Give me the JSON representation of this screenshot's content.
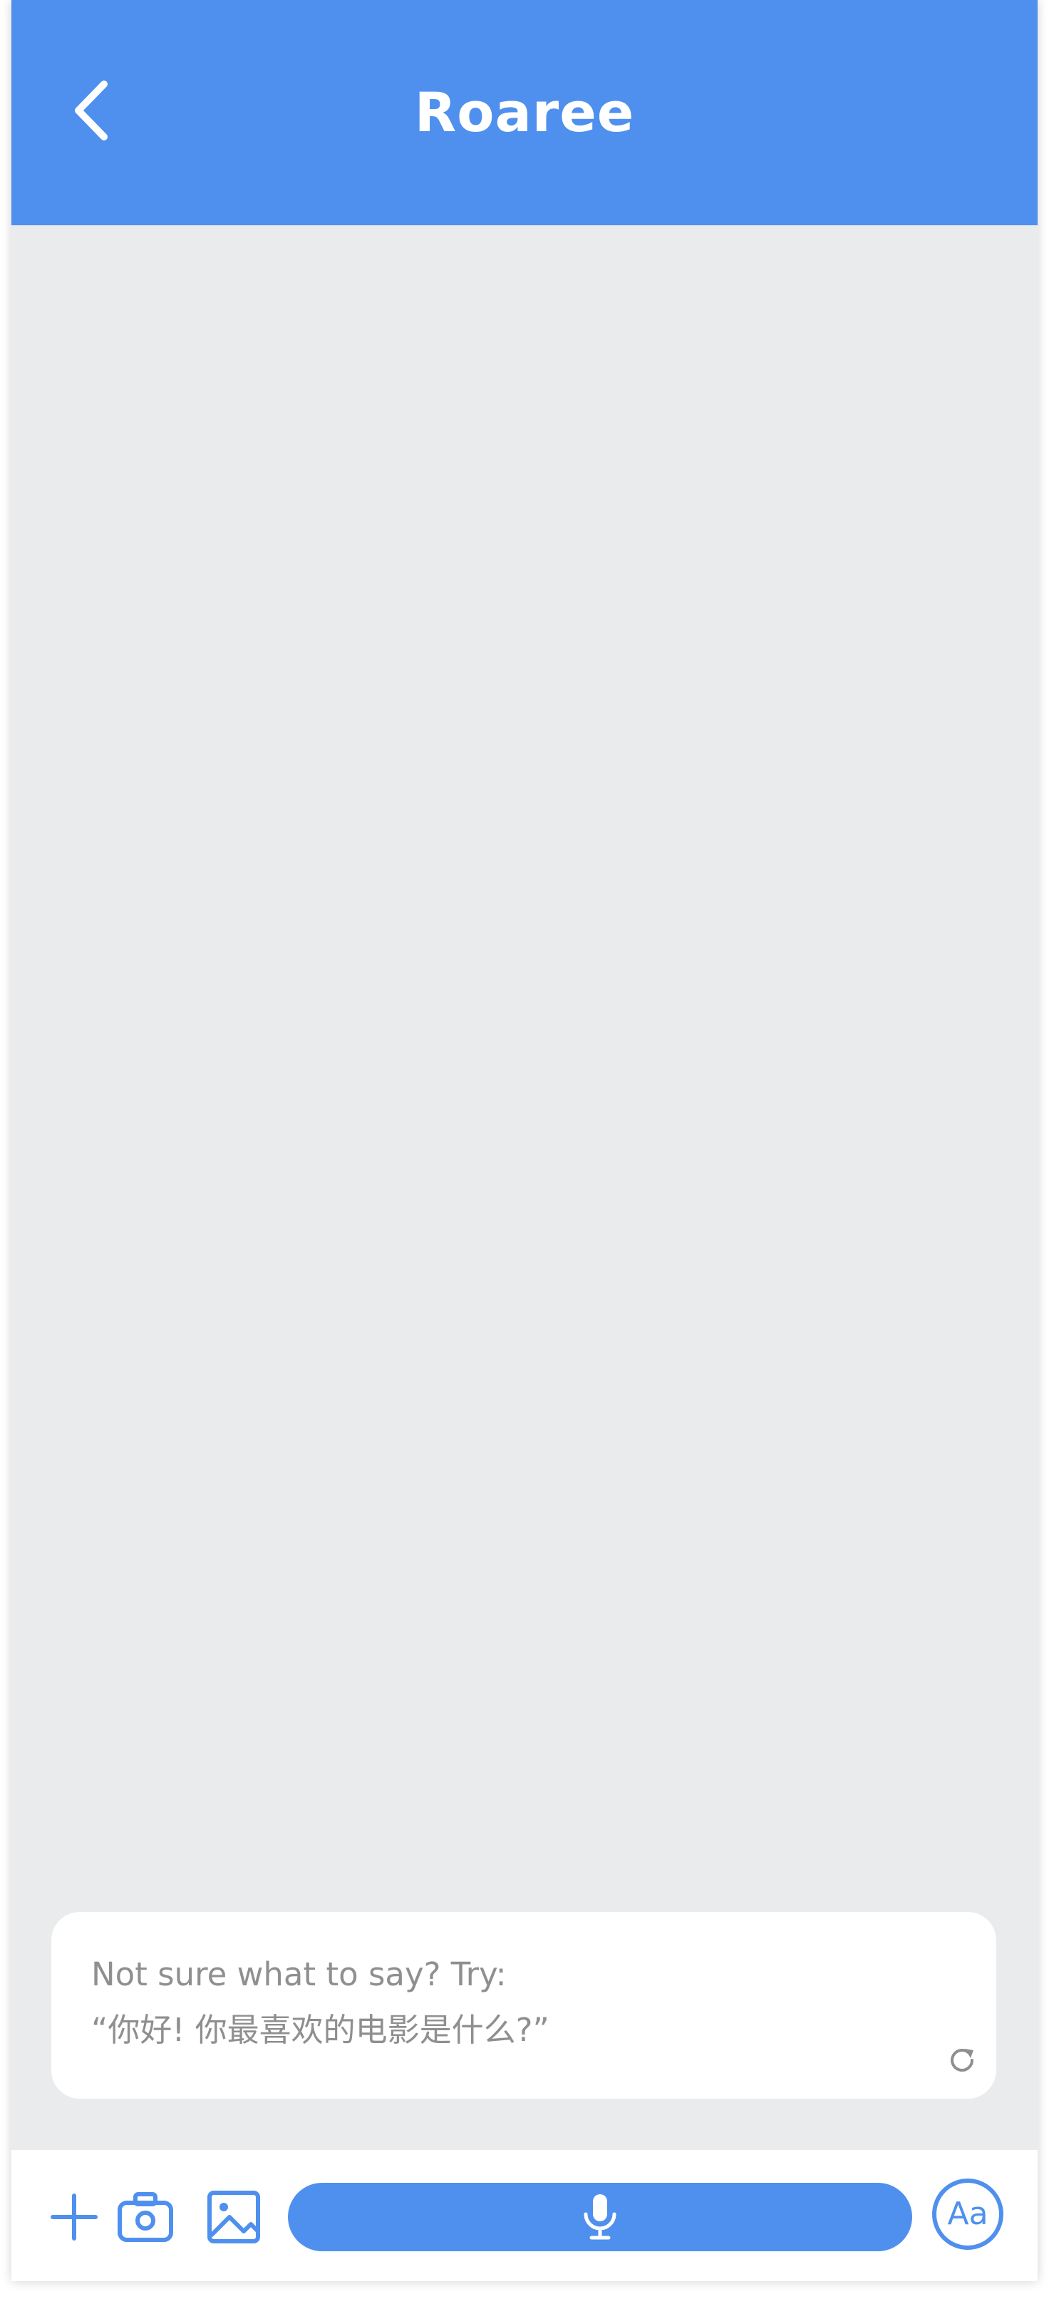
{
  "header": {
    "title": "Roaree",
    "back_icon": "chevron-left-icon"
  },
  "suggestion": {
    "prompt": "Not sure what to say? Try:",
    "text": "“你好! 你最喜欢的电影是什么?”",
    "refresh_icon": "refresh-icon"
  },
  "toolbar": {
    "plus_icon": "plus-icon",
    "camera_icon": "camera-icon",
    "image_icon": "image-icon",
    "mic_icon": "microphone-icon",
    "text_toggle_label": "Aa"
  },
  "colors": {
    "accent": "#4f90ee",
    "background": "#e9ebed",
    "card": "#ffffff",
    "muted_text": "#8f8f8f"
  }
}
